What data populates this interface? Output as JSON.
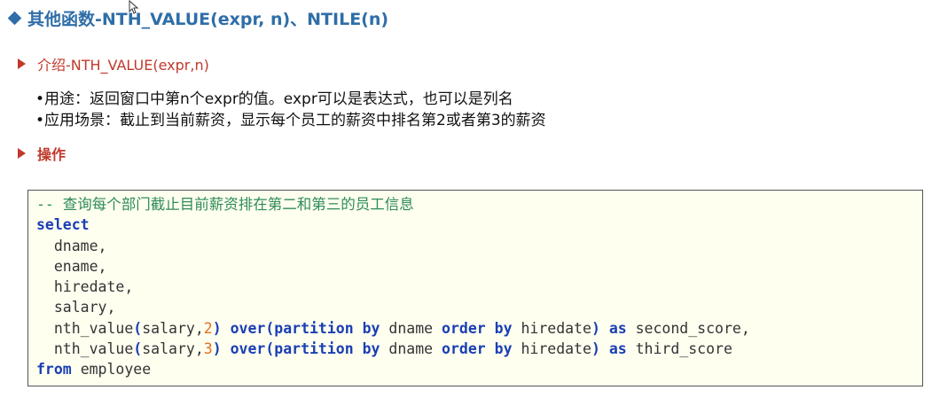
{
  "title": "其他函数-NTH_VALUE(expr, n)、NTILE(n)",
  "section_intro": "介绍-NTH_VALUE(expr,n)",
  "bullets": [
    "•用途：返回窗口中第n个expr的值。expr可以是表达式，也可以是列名",
    "•应用场景：截止到当前薪资，显示每个员工的薪资中排名第2或者第3的薪资"
  ],
  "section_ops": "操作",
  "code": {
    "comment": "-- 查询每个部门截止目前薪资排在第二和第三的员工信息",
    "kw_select": "select",
    "col_dname": "  dname,",
    "col_ename": "  ename,",
    "col_hiredate": "  hiredate,",
    "col_salary": "  salary,",
    "nth1_fn": "  nth_value",
    "nth1_args": "(salary,",
    "nth1_n": "2",
    "nth1_close": ")",
    "nth2_fn": "  nth_value",
    "nth2_args": "(salary,",
    "nth2_n": "3",
    "nth2_close": ")",
    "kw_over": "over",
    "kw_over_paren": "(",
    "kw_partition": "partition",
    "kw_by": "by",
    "kw_order": "order",
    "part_col": "dname",
    "order_col": "hiredate",
    "close_paren": ")",
    "kw_as": "as",
    "alias1": "second_score,",
    "alias2": "third_score",
    "kw_from": "from",
    "table": "employee"
  },
  "colors": {
    "title": "#2f6ea8",
    "section": "#c0392b",
    "code_bg": "#fffff0",
    "keyword": "#1a3fb4",
    "comment": "#2e8b57",
    "number": "#e0701a"
  }
}
